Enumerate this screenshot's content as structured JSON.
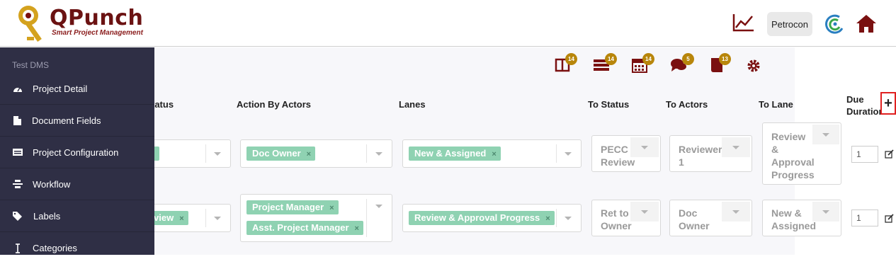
{
  "app": {
    "logo_title": "QPunch",
    "logo_subtitle": "Smart Project Management",
    "org_button": "Petrocon",
    "brand_color": "#7a1010",
    "accent_tag_color": "#8fd2b2"
  },
  "sidebar": {
    "title": "Test DMS",
    "items": [
      {
        "label": "Project Detail",
        "icon": "dashboard-icon"
      },
      {
        "label": "Document Fields",
        "icon": "document-icon"
      },
      {
        "label": "Project Configuration",
        "icon": "configuration-icon"
      },
      {
        "label": "Workflow",
        "icon": "workflow-icon"
      },
      {
        "label": "Labels",
        "icon": "tags-icon"
      },
      {
        "label": "Categories",
        "icon": "category-icon"
      }
    ]
  },
  "toolbar": {
    "badges": [
      "14",
      "14",
      "14",
      "5",
      "13"
    ]
  },
  "table": {
    "headers": {
      "from_status_partial": "tatus",
      "action_by_actors": "Action By Actors",
      "lanes": "Lanes",
      "to_status": "To Status",
      "to_actors": "To Actors",
      "to_lane": "To Lane",
      "due_duration_1": "Due",
      "due_duration_2": "Duration"
    },
    "add_button": "+",
    "rows": [
      {
        "from_status_tag": "",
        "actors": [
          "Doc Owner"
        ],
        "lanes": [
          "New & Assigned"
        ],
        "to_status": [
          "PECC",
          "Review"
        ],
        "to_actors": [
          "Reviewer",
          "1"
        ],
        "to_lane": [
          "Review",
          "&",
          "Approval",
          "Progress"
        ],
        "due": "1"
      },
      {
        "from_status_tag": "view",
        "actors": [
          "Project Manager",
          "Asst. Project Manager"
        ],
        "lanes": [
          "Review & Approval Progress"
        ],
        "to_status": [
          "Ret to",
          "Owner"
        ],
        "to_actors": [
          "Doc",
          "Owner"
        ],
        "to_lane": [
          "New &",
          "Assigned"
        ],
        "due": "1"
      }
    ],
    "tag_remove": "×"
  }
}
